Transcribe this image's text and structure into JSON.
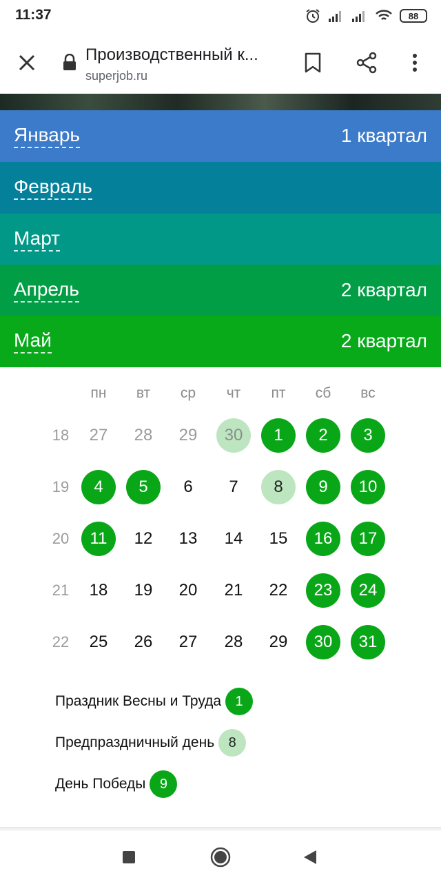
{
  "status_bar": {
    "time": "11:37",
    "battery": "88",
    "icons": [
      "alarm-icon",
      "signal-icon",
      "signal-icon",
      "wifi-icon",
      "battery-icon"
    ]
  },
  "toolbar": {
    "title": "Производственный к...",
    "url": "superjob.ru"
  },
  "months": [
    {
      "name": "Январь",
      "quarter": "1 квартал",
      "color": "#3b7bca"
    },
    {
      "name": "Февраль",
      "quarter": "",
      "color": "#05809b"
    },
    {
      "name": "Март",
      "quarter": "",
      "color": "#029888"
    },
    {
      "name": "Апрель",
      "quarter": "2 квартал",
      "color": "#019e45"
    },
    {
      "name": "Май",
      "quarter": "2 квартал",
      "color": "#08aa1a"
    }
  ],
  "calendar": {
    "weekdays": [
      "пн",
      "вт",
      "ср",
      "чт",
      "пт",
      "сб",
      "вс"
    ],
    "weeks": [
      {
        "number": "18",
        "days": [
          {
            "d": "27",
            "type": "muted"
          },
          {
            "d": "28",
            "type": "muted"
          },
          {
            "d": "29",
            "type": "muted"
          },
          {
            "d": "30",
            "type": "pre-muted"
          },
          {
            "d": "1",
            "type": "hol"
          },
          {
            "d": "2",
            "type": "hol"
          },
          {
            "d": "3",
            "type": "hol"
          }
        ]
      },
      {
        "number": "19",
        "days": [
          {
            "d": "4",
            "type": "hol"
          },
          {
            "d": "5",
            "type": "hol"
          },
          {
            "d": "6",
            "type": "work"
          },
          {
            "d": "7",
            "type": "work"
          },
          {
            "d": "8",
            "type": "pre"
          },
          {
            "d": "9",
            "type": "hol"
          },
          {
            "d": "10",
            "type": "hol"
          }
        ]
      },
      {
        "number": "20",
        "days": [
          {
            "d": "11",
            "type": "hol"
          },
          {
            "d": "12",
            "type": "work"
          },
          {
            "d": "13",
            "type": "work"
          },
          {
            "d": "14",
            "type": "work"
          },
          {
            "d": "15",
            "type": "work"
          },
          {
            "d": "16",
            "type": "hol"
          },
          {
            "d": "17",
            "type": "hol"
          }
        ]
      },
      {
        "number": "21",
        "days": [
          {
            "d": "18",
            "type": "work"
          },
          {
            "d": "19",
            "type": "work"
          },
          {
            "d": "20",
            "type": "work"
          },
          {
            "d": "21",
            "type": "work"
          },
          {
            "d": "22",
            "type": "work"
          },
          {
            "d": "23",
            "type": "hol"
          },
          {
            "d": "24",
            "type": "hol"
          }
        ]
      },
      {
        "number": "22",
        "days": [
          {
            "d": "25",
            "type": "work"
          },
          {
            "d": "26",
            "type": "work"
          },
          {
            "d": "27",
            "type": "work"
          },
          {
            "d": "28",
            "type": "work"
          },
          {
            "d": "29",
            "type": "work"
          },
          {
            "d": "30",
            "type": "hol"
          },
          {
            "d": "31",
            "type": "hol"
          }
        ]
      }
    ]
  },
  "legend": [
    {
      "label": "Праздник Весны и Труда",
      "day": "1",
      "type": "hol"
    },
    {
      "label": "Предпраздничный день",
      "day": "8",
      "type": "pre"
    },
    {
      "label": "День Победы",
      "day": "9",
      "type": "hol"
    }
  ],
  "colors": {
    "holiday": "#09a718",
    "pre_holiday": "#bde6c0"
  },
  "nav_icons": [
    "recent-apps-icon",
    "home-icon",
    "back-icon"
  ]
}
